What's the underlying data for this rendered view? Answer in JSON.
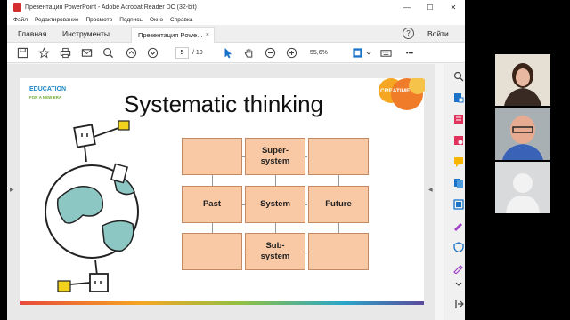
{
  "window": {
    "title": "Презентация PowerPoint - Adobe Acrobat Reader DC (32-bit)",
    "minimize": "—",
    "maximize": "☐",
    "close": "✕"
  },
  "menu": [
    "Файл",
    "Редактирование",
    "Просмотр",
    "Подпись",
    "Окно",
    "Справка"
  ],
  "tabs": {
    "home": "Главная",
    "tools": "Инструменты",
    "document": "Презентация Powe...",
    "close": "×",
    "help": "?",
    "signin": "Войти"
  },
  "toolbar": {
    "current_page": "5",
    "total_pages": "/ 10",
    "zoom": "55,6%",
    "more": "•••"
  },
  "slide": {
    "logo_line1": "EDUCATION",
    "logo_line2": "FOR A NEW ERA",
    "title": "Systematic thinking",
    "brand": "CREATIME",
    "cells": {
      "top_left": "",
      "top_center": "Super-\nsystem",
      "top_right": "",
      "mid_left": "Past",
      "mid_center": "System",
      "mid_right": "Future",
      "bottom_left": "",
      "bottom_center": "Sub-\nsystem",
      "bottom_right": ""
    }
  },
  "colors": {
    "cell_fill": "#f9c8a4",
    "accent": "#f5a623",
    "logo_blue": "#1e88c8",
    "logo_green": "#6aa92e"
  },
  "icons": [
    "save-icon",
    "bookmark-star-icon",
    "print-icon",
    "email-icon",
    "zoom-out-search-icon",
    "page-up-icon",
    "page-down-icon",
    "select-cursor-icon",
    "hand-icon",
    "zoom-minus-icon",
    "zoom-plus-icon",
    "fit-page-icon",
    "keyboard-icon"
  ]
}
